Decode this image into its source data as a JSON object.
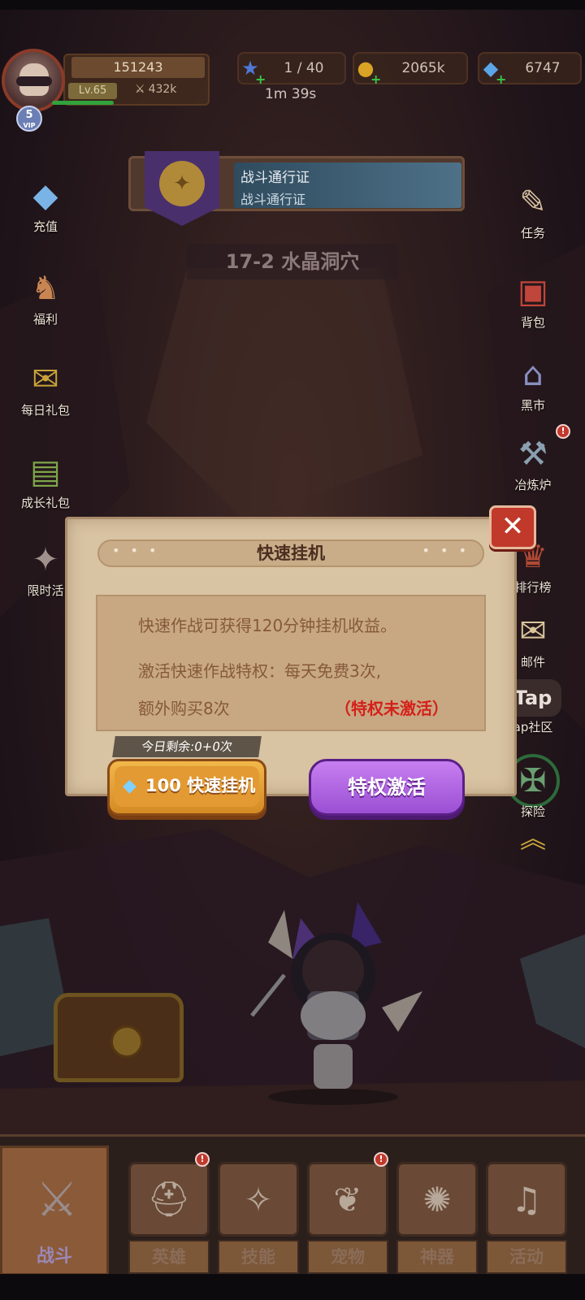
{
  "player": {
    "score": "151243",
    "level": "Lv.65",
    "power": "432k",
    "vip": "5",
    "vip_tag": "VIP"
  },
  "resources": {
    "energy": "1 / 40",
    "gold": "2065k",
    "gems": "6747",
    "timer": "1m 39s"
  },
  "left_menu": [
    {
      "label": "充值",
      "icon": "gem-pile-icon"
    },
    {
      "label": "福利",
      "icon": "wizard-icon"
    },
    {
      "label": "每日礼包",
      "icon": "gift-box-icon"
    },
    {
      "label": "成长礼包",
      "icon": "growth-pack-icon"
    },
    {
      "label": "限时活",
      "icon": "limited-event-icon"
    }
  ],
  "right_menu": [
    {
      "label": "任务",
      "icon": "scroll-quill-icon"
    },
    {
      "label": "背包",
      "icon": "backpack-icon"
    },
    {
      "label": "黑市",
      "icon": "market-stall-icon"
    },
    {
      "label": "冶炼炉",
      "icon": "anvil-icon"
    },
    {
      "label": "排行榜",
      "icon": "ranking-icon"
    },
    {
      "label": "邮件",
      "icon": "mail-icon"
    },
    {
      "label": "ap社区",
      "icon": "tap-community-icon",
      "logo": "Tap"
    },
    {
      "label": "探险",
      "icon": "explore-icon"
    }
  ],
  "battle_pass": {
    "title": "战斗通行证",
    "subtitle": "战斗通行证"
  },
  "stage": {
    "label": "17-2 水晶洞穴"
  },
  "modal": {
    "title": "快速挂机",
    "line1": "快速作战可获得120分钟挂机收益。",
    "line2": "激活快速作战特权：每天免费3次,",
    "line3": "额外购买8次",
    "status": "（特权未激活）",
    "remaining": "今日剩余:0+0次",
    "quick_button": "100 快速挂机",
    "activate_button": "特权激活",
    "close": "✕"
  },
  "bottom_tabs": [
    {
      "label": "战斗",
      "icon": "crossed-swords-icon"
    },
    {
      "label": "英雄",
      "icon": "knight-helmet-icon"
    },
    {
      "label": "技能",
      "icon": "spellbook-icon"
    },
    {
      "label": "宠物",
      "icon": "winged-pet-icon"
    },
    {
      "label": "神器",
      "icon": "artifact-icon"
    },
    {
      "label": "活动",
      "icon": "horn-icon"
    }
  ],
  "colors": {
    "accent_orange": "#e39a32",
    "accent_purple": "#9b4fd3",
    "warning_red": "#d4201a",
    "close_red": "#c0392b",
    "paper": "#d8c3a2"
  }
}
